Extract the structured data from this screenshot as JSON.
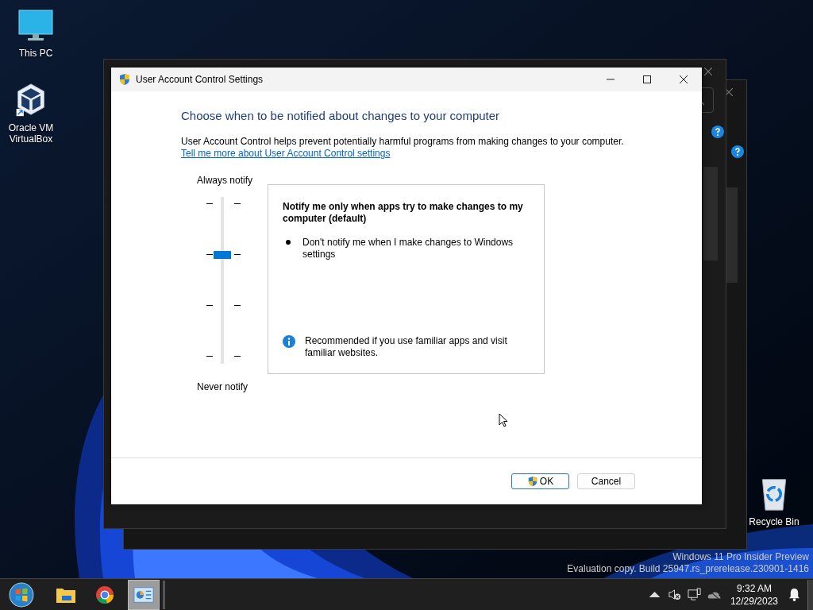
{
  "desktop_icons": [
    {
      "label": "This PC",
      "kind": "pc"
    },
    {
      "label": "Oracle VM VirtualBox",
      "kind": "virtualbox"
    },
    {
      "label": "Recycle Bin",
      "kind": "recycle"
    }
  ],
  "dialog": {
    "title": "User Account Control Settings",
    "heading": "Choose when to be notified about changes to your computer",
    "description": "User Account Control helps prevent potentially harmful programs from making changes to your computer.",
    "link": "Tell me more about User Account Control settings",
    "slider": {
      "top_label": "Always notify",
      "bottom_label": "Never notify",
      "level": 0.6667
    },
    "info_panel": {
      "title": "Notify me only when apps try to make changes to my computer (default)",
      "bullets": [
        "Don't notify me when I make changes to Windows settings"
      ],
      "note": "Recommended if you use familiar apps and visit familiar websites."
    },
    "buttons": [
      {
        "label": "OK",
        "kind": "primary"
      },
      {
        "label": "Cancel",
        "kind": "secondary"
      }
    ]
  },
  "system_notice": [
    "Windows 11 Pro Insider Preview",
    "Evaluation copy. Build 25947.rs_prerelease.230901-1416"
  ],
  "taskbar": {
    "apps": [
      {
        "kind": "explorer",
        "selected": false
      },
      {
        "kind": "chrome",
        "selected": false
      },
      {
        "kind": "control-panel",
        "selected": true
      }
    ],
    "clock": {
      "time": "9:32 AM",
      "date": "12/29/2023"
    }
  }
}
